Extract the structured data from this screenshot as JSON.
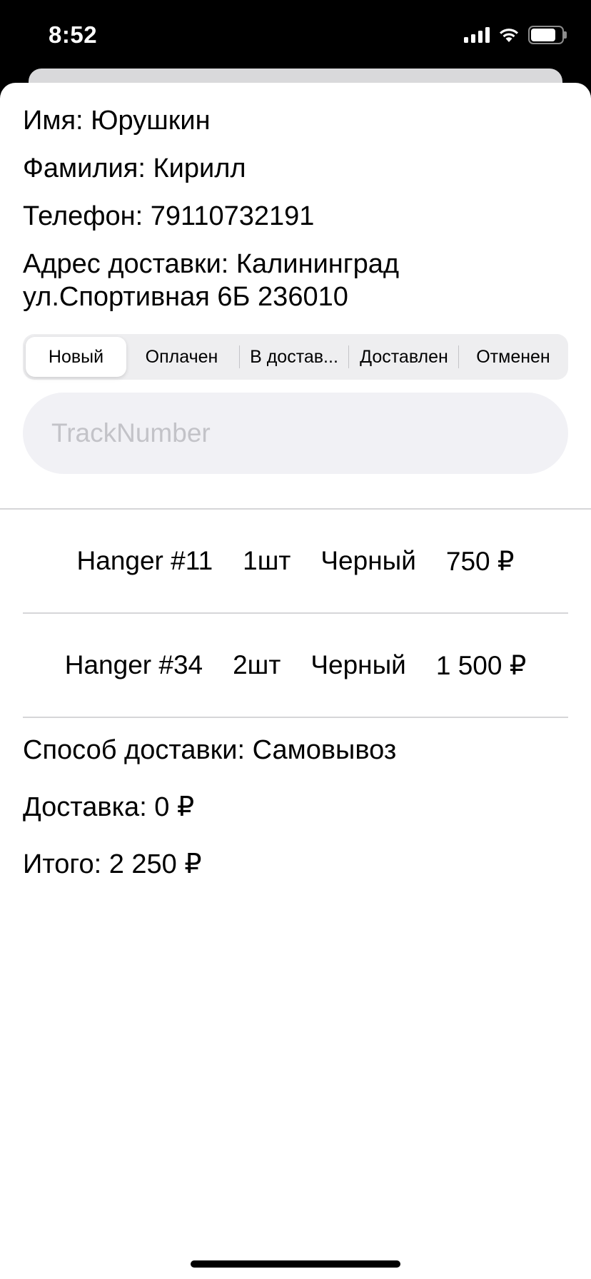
{
  "status_bar": {
    "time": "8:52",
    "battery_level": 0.82
  },
  "customer": {
    "first_name_line": "Имя: Юрушкин",
    "last_name_line": "Фамилия: Кирилл",
    "phone_line": "Телефон: 79110732191",
    "address_line_1": "Адрес доставки: Калининград",
    "address_line_2": "ул.Спортивная 6Б 236010"
  },
  "status_segments": {
    "selected_index": 0,
    "items": [
      {
        "label": "Новый"
      },
      {
        "label": "Оплачен"
      },
      {
        "label": "В достав..."
      },
      {
        "label": "Доставлен"
      },
      {
        "label": "Отменен"
      }
    ]
  },
  "track_input": {
    "placeholder": "TrackNumber",
    "value": ""
  },
  "order_items": [
    {
      "name": "Hanger #11",
      "quantity": "1шт",
      "color": "Черный",
      "price": "750 ₽"
    },
    {
      "name": "Hanger #34",
      "quantity": "2шт",
      "color": "Черный",
      "price": "1 500 ₽"
    }
  ],
  "summary": {
    "delivery_method_line": "Способ доставки: Самовывоз",
    "delivery_cost_line": "Доставка: 0 ₽",
    "total_line": "Итого: 2 250 ₽"
  }
}
